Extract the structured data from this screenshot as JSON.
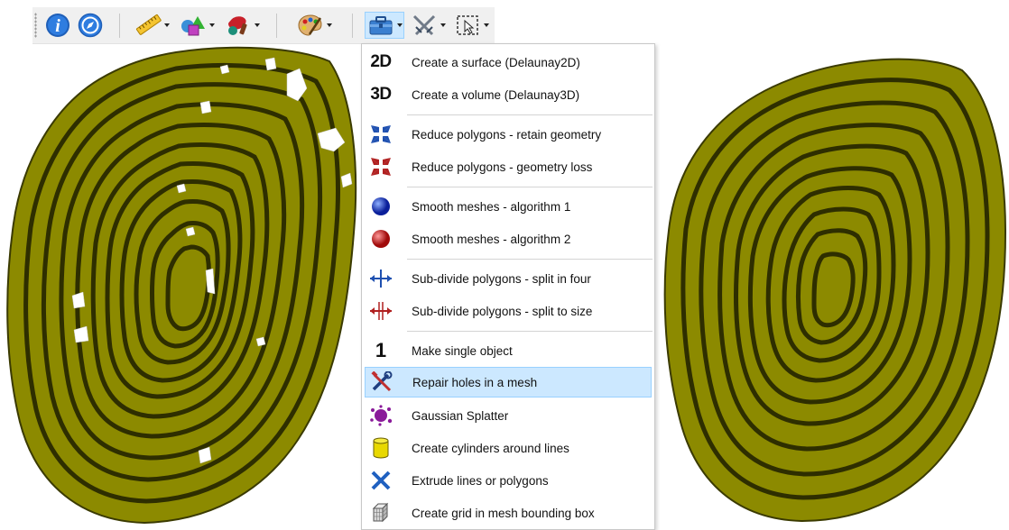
{
  "toolbar": {
    "buttons": [
      {
        "name": "info-icon",
        "dropdown": false
      },
      {
        "name": "compass-icon",
        "dropdown": false
      },
      {
        "name": "ruler-icon",
        "dropdown": true
      },
      {
        "name": "shapes-icon",
        "dropdown": true
      },
      {
        "name": "paint-icon",
        "dropdown": true
      },
      {
        "name": "palette-icon",
        "dropdown": true
      },
      {
        "name": "toolbox-icon",
        "dropdown": true,
        "active": true
      },
      {
        "name": "swords-icon",
        "dropdown": true
      },
      {
        "name": "selection-icon",
        "dropdown": true
      }
    ]
  },
  "menu": {
    "items": [
      {
        "label": "Create a surface (Delaunay2D)",
        "icon": "2d-icon"
      },
      {
        "label": "Create a volume (Delaunay3D)",
        "icon": "3d-icon"
      },
      {
        "label": "Reduce polygons - retain geometry",
        "icon": "reduce-blue-icon"
      },
      {
        "label": "Reduce polygons - geometry loss",
        "icon": "reduce-red-icon"
      },
      {
        "label": "Smooth meshes - algorithm 1",
        "icon": "blue-sphere-icon"
      },
      {
        "label": "Smooth meshes - algorithm 2",
        "icon": "red-sphere-icon"
      },
      {
        "label": "Sub-divide polygons - split in four",
        "icon": "split-blue-icon"
      },
      {
        "label": "Sub-divide polygons - split to size",
        "icon": "split-red-icon"
      },
      {
        "label": "Make single object",
        "icon": "one-icon"
      },
      {
        "label": "Repair holes in a mesh",
        "icon": "repair-tools-icon",
        "highlighted": true
      },
      {
        "label": "Gaussian Splatter",
        "icon": "splatter-icon"
      },
      {
        "label": "Create cylinders around lines",
        "icon": "cylinder-icon"
      },
      {
        "label": "Extrude lines or polygons",
        "icon": "extrude-icon"
      },
      {
        "label": "Create grid in mesh bounding box",
        "icon": "grid-cube-icon"
      }
    ],
    "glyph_2d": "2D",
    "glyph_3d": "3D",
    "glyph_1": "1"
  },
  "colors": {
    "mesh": "#8c8a00",
    "mesh_dark": "#2e2e00",
    "highlight": "#cce8ff",
    "highlight_border": "#99d1ff"
  }
}
